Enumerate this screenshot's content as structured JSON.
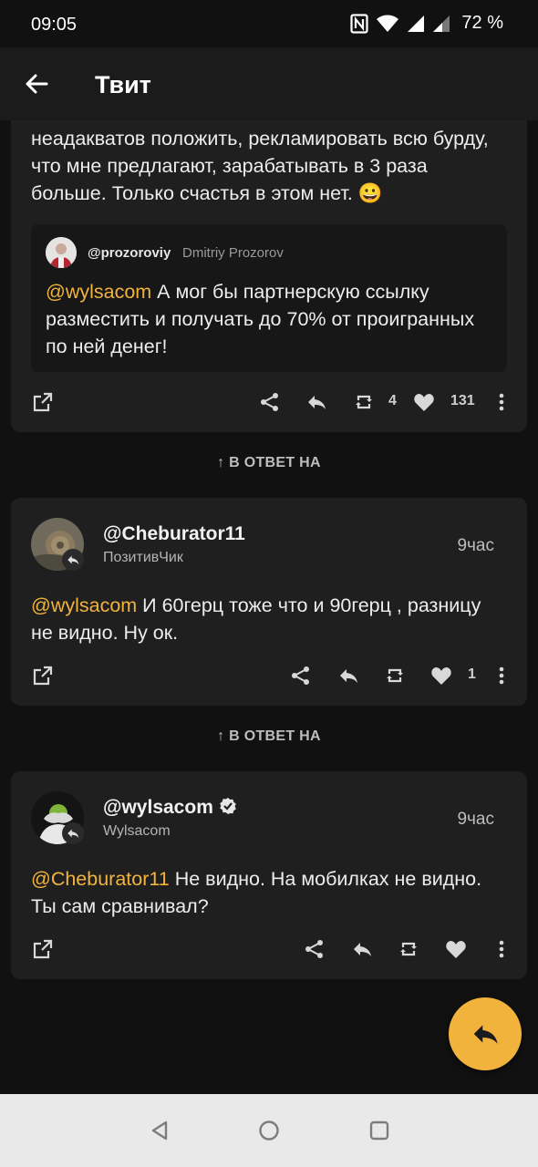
{
  "status_bar": {
    "time": "09:05",
    "battery": "72 %"
  },
  "app_bar": {
    "title": "Твит"
  },
  "colors": {
    "accent": "#f2b33d",
    "background": "#111111",
    "card": "#1f1f1f"
  },
  "main_tweet": {
    "text": "неадакватов положить, рекламировать всю бурду, что мне предлагают, зарабатывать в 3 раза больше. Только счастья в этом нет. 😀",
    "quote": {
      "handle": "@prozoroviy",
      "name": "Dmitriy Prozorov",
      "mention": "@wylsacom",
      "text": " А мог бы партнерскую ссылку разместить и получать до 70% от проигранных по ней денег!"
    },
    "retweets": "4",
    "likes": "131"
  },
  "reply_label_1": "↑ В ОТВЕТ НА",
  "reply_label_2": "↑ В ОТВЕТ НА",
  "tweet2": {
    "handle": "@Cheburator11",
    "name": "ПозитивЧик",
    "time": "9час",
    "mention": "@wylsacom",
    "text": " И 60герц тоже что и 90герц , разницу не видно. Ну ок.",
    "likes": "1"
  },
  "tweet3": {
    "handle": "@wylsacom",
    "name": "Wylsacom",
    "time": "9час",
    "mention": "@Cheburator11",
    "text": " Не видно. На мобилках не видно. Ты сам сравнивал?"
  },
  "icons": [
    "back-arrow-icon",
    "open-external-icon",
    "share-icon",
    "reply-icon",
    "retweet-icon",
    "heart-icon",
    "more-vert-icon",
    "verified-icon",
    "fab-reply-icon",
    "nav-back-icon",
    "nav-home-icon",
    "nav-recents-icon"
  ]
}
